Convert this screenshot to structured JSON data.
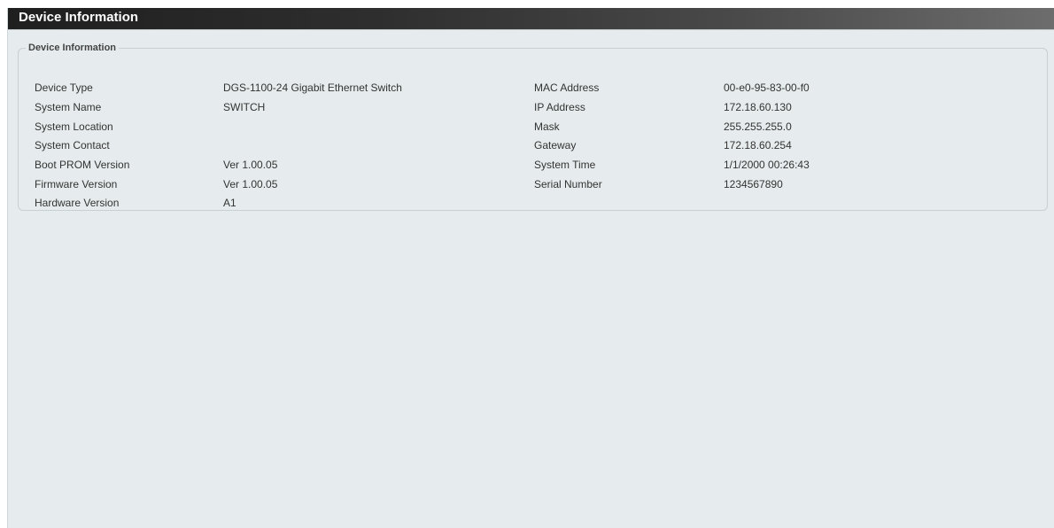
{
  "header": {
    "title": "Device Information"
  },
  "panel": {
    "legend": "Device Information",
    "left_rows": [
      {
        "label": "Device Type",
        "value": "DGS-1100-24 Gigabit Ethernet Switch"
      },
      {
        "label": "System Name",
        "value": "SWITCH"
      },
      {
        "label": "System Location",
        "value": ""
      },
      {
        "label": "System Contact",
        "value": ""
      },
      {
        "label": "Boot PROM Version",
        "value": "Ver 1.00.05"
      },
      {
        "label": "Firmware Version",
        "value": "Ver 1.00.05"
      },
      {
        "label": "Hardware Version",
        "value": "A1"
      }
    ],
    "right_rows": [
      {
        "label": "MAC Address",
        "value": "00-e0-95-83-00-f0"
      },
      {
        "label": "IP Address",
        "value": "172.18.60.130"
      },
      {
        "label": "Mask",
        "value": "255.255.255.0"
      },
      {
        "label": "Gateway",
        "value": "172.18.60.254"
      },
      {
        "label": "System Time",
        "value": "1/1/2000 00:26:43"
      },
      {
        "label": "Serial Number",
        "value": "1234567890"
      }
    ]
  }
}
